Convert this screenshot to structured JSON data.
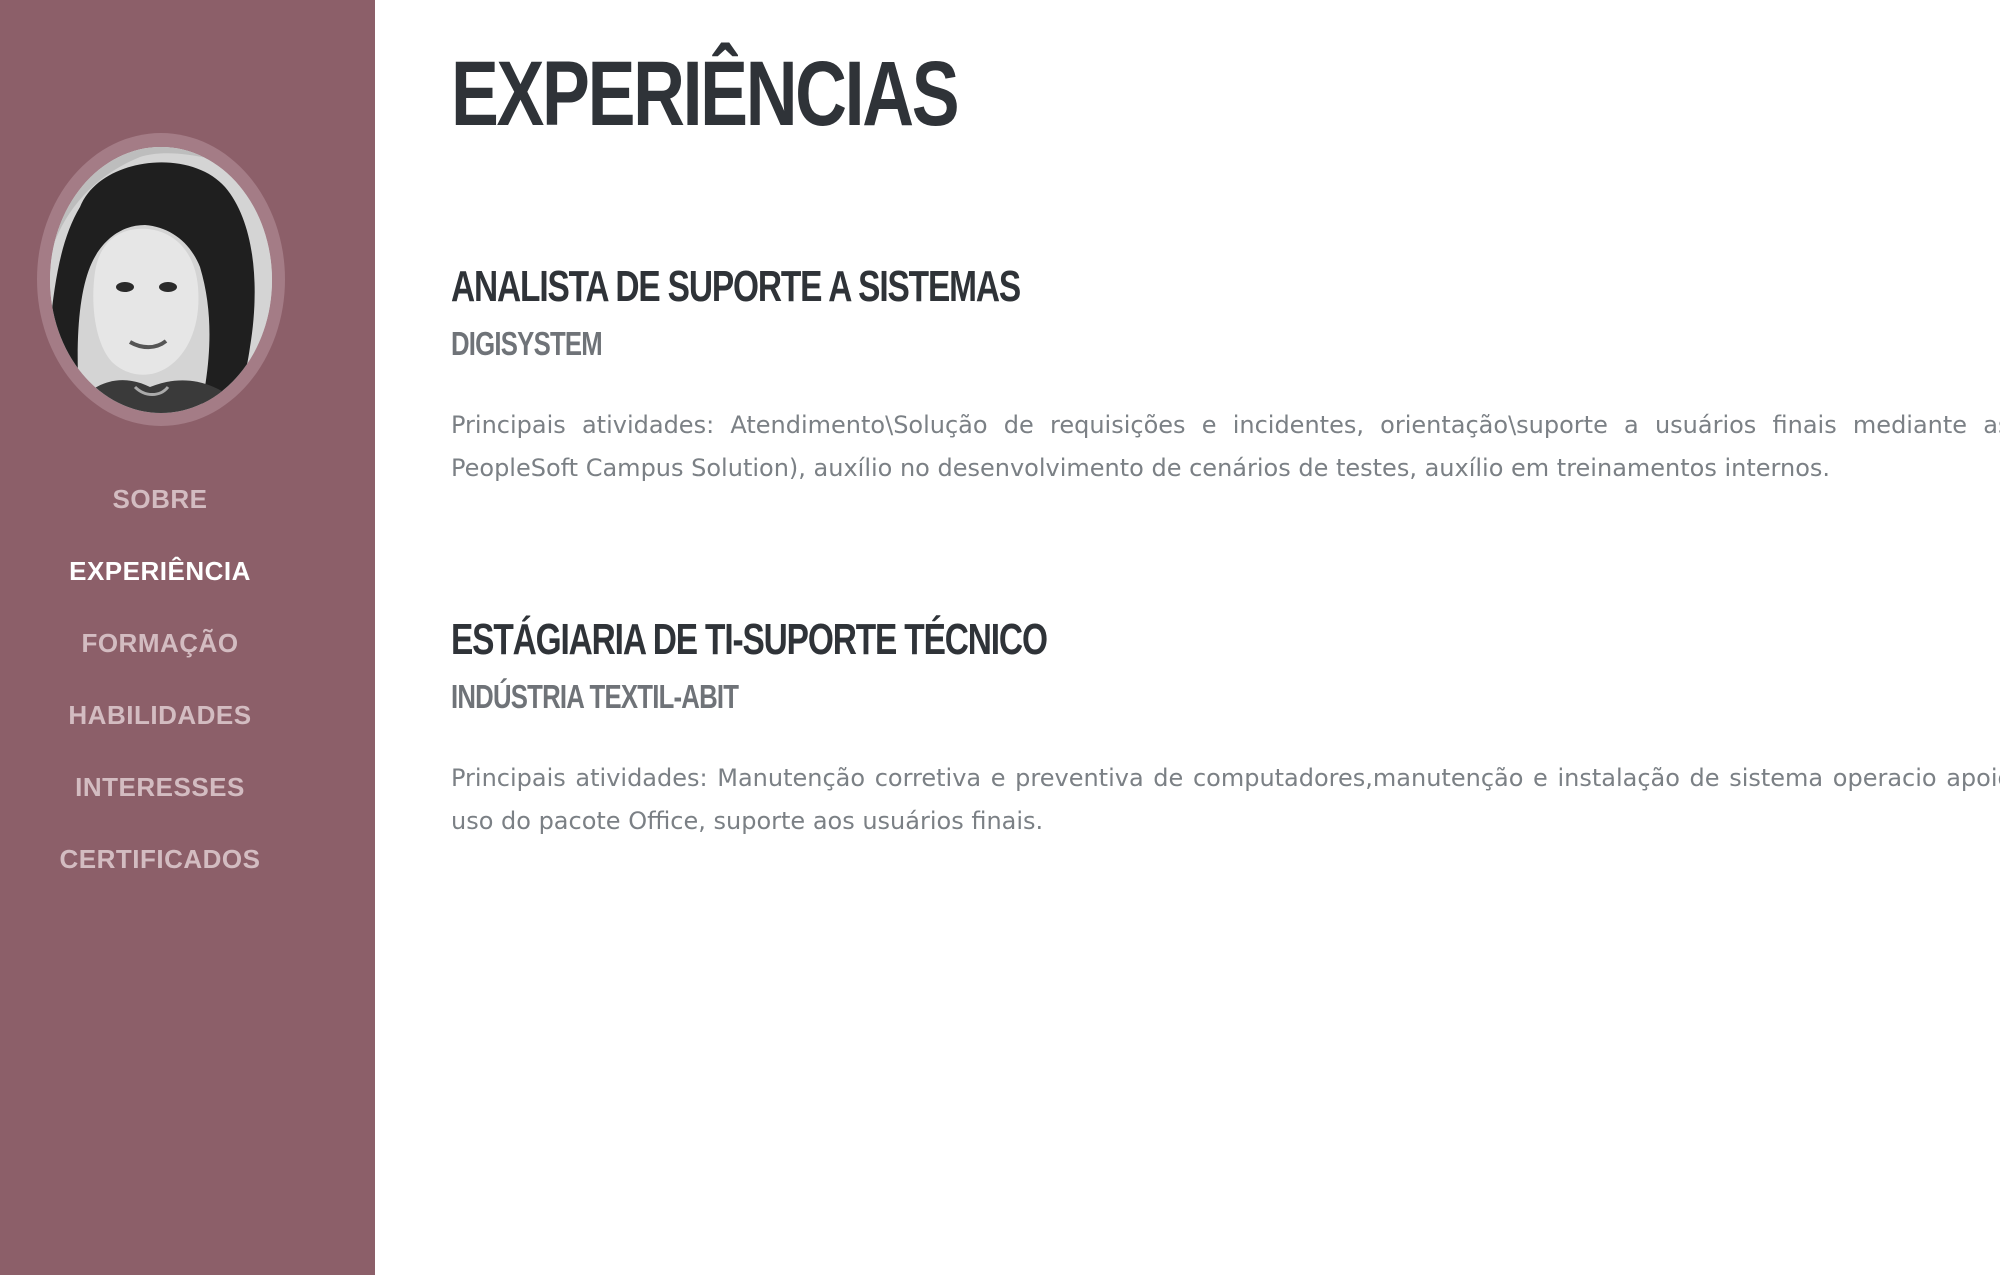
{
  "sidebar": {
    "avatar_alt": "Foto de perfil",
    "nav": [
      {
        "label": "SOBRE",
        "active": false
      },
      {
        "label": "EXPERIÊNCIA",
        "active": true
      },
      {
        "label": "FORMAÇÃO",
        "active": false
      },
      {
        "label": "HABILIDADES",
        "active": false
      },
      {
        "label": "INTERESSES",
        "active": false
      },
      {
        "label": "CERTIFICADOS",
        "active": false
      }
    ]
  },
  "main": {
    "title": "EXPERIÊNCIAS",
    "experiences": [
      {
        "title": "ANALISTA DE SUPORTE A SISTEMAS",
        "company": "DIGISYSTEM",
        "description": "Principais atividades: Atendimento\\Solução de requisições e incidentes, orientação\\suporte a usuários finais mediante as regras sis PeopleSoft Campus Solution), auxílio no desenvolvimento de cenários de testes, auxílio em treinamentos internos."
      },
      {
        "title": "ESTÁGIARIA DE TI-SUPORTE TÉCNICO",
        "company": "INDÚSTRIA TEXTIL-ABIT",
        "description": "Principais atividades: Manutenção corretiva e preventiva de computadores,manutenção e instalação de sistema operacio apoio\\suporte ao uso do pacote Office, suporte aos usuários finais."
      }
    ]
  },
  "colors": {
    "sidebar_bg": "#8c5f69",
    "avatar_ring": "#a47c86",
    "nav_inactive": "#d3bcc1",
    "nav_active": "#ffffff",
    "heading": "#2f3338",
    "subheading": "#6f7378",
    "body_text": "#7b8085"
  }
}
